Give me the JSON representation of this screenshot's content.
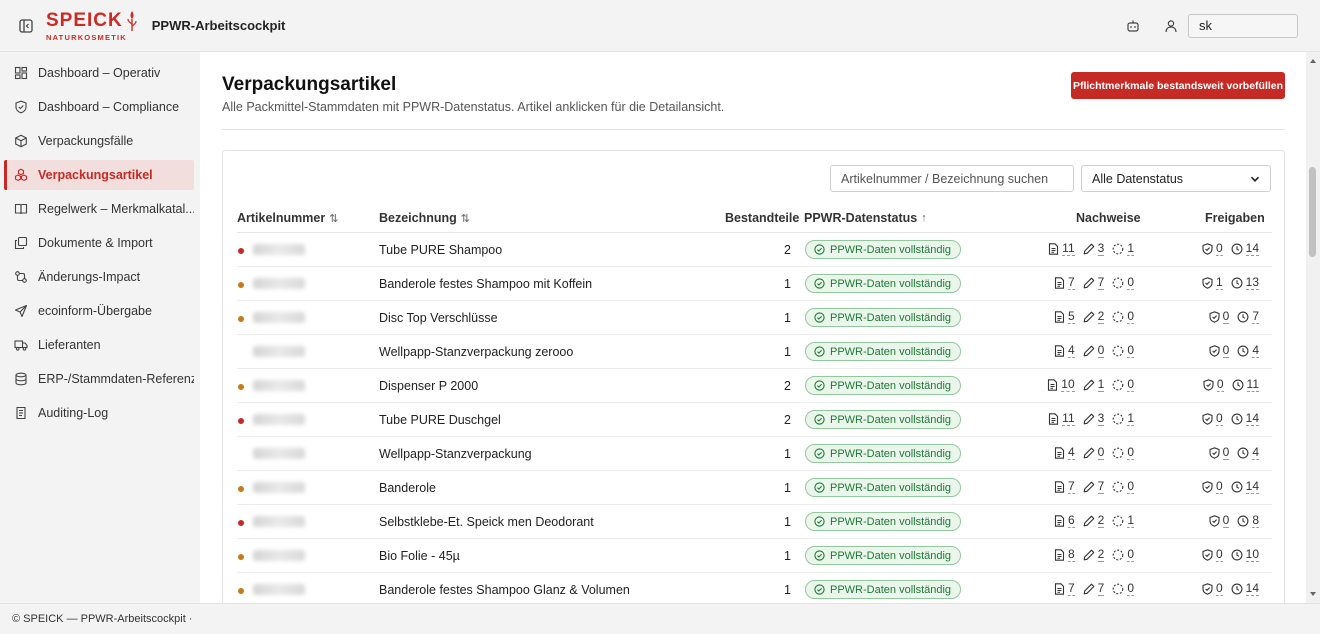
{
  "header": {
    "brand_word": "SPEICK",
    "brand_sub": "NATURKOSMETIK",
    "app_title": "PPWR-Arbeitscockpit",
    "user_value": "sk"
  },
  "sidebar": {
    "items": [
      {
        "label": "Dashboard – Operativ",
        "icon": "dashboard-grid-icon"
      },
      {
        "label": "Dashboard – Compliance",
        "icon": "shield-check-icon"
      },
      {
        "label": "Verpackungsfälle",
        "icon": "package-icon"
      },
      {
        "label": "Verpackungsartikel",
        "icon": "boxes-icon",
        "active": true
      },
      {
        "label": "Regelwerk – Merkmalkatal...",
        "icon": "book-icon"
      },
      {
        "label": "Dokumente & Import",
        "icon": "documents-icon"
      },
      {
        "label": "Änderungs-Impact",
        "icon": "impact-icon"
      },
      {
        "label": "ecoinform-Übergabe",
        "icon": "send-icon"
      },
      {
        "label": "Lieferanten",
        "icon": "truck-icon"
      },
      {
        "label": "ERP-/Stammdaten-Referenz",
        "icon": "database-icon"
      },
      {
        "label": "Auditing-Log",
        "icon": "log-icon"
      }
    ]
  },
  "main": {
    "title": "Verpackungsartikel",
    "subtitle": "Alle Packmittel-Stammdaten mit PPWR-Datenstatus. Artikel anklicken für die Detailansicht.",
    "prefill_button": "Pflichtmerkmale bestandsweit vorbefüllen",
    "search_placeholder": "Artikelnummer / Bezeichnung suchen",
    "status_filter": "Alle Datenstatus"
  },
  "table": {
    "columns": {
      "artikelnummer": "Artikelnummer",
      "bezeichnung": "Bezeichnung",
      "bestandteile": "Bestandteile",
      "datenstatus": "PPWR-Datenstatus",
      "nachweise": "Nachweise",
      "freigaben": "Freigaben"
    },
    "rows": [
      {
        "dot": "#c62a24",
        "bezeichnung": "Tube PURE Shampoo",
        "bestandteile": "2",
        "status": "PPWR-Daten vollständig",
        "docs": "11",
        "edits": "3",
        "pending": "1",
        "approved": "0",
        "waiting": "14"
      },
      {
        "dot": "#c97a16",
        "bezeichnung": "Banderole festes Shampoo mit Koffein",
        "bestandteile": "1",
        "status": "PPWR-Daten vollständig",
        "docs": "7",
        "edits": "7",
        "pending": "0",
        "approved": "1",
        "waiting": "13"
      },
      {
        "dot": "#c97a16",
        "bezeichnung": "Disc Top Verschlüsse",
        "bestandteile": "1",
        "status": "PPWR-Daten vollständig",
        "docs": "5",
        "edits": "2",
        "pending": "0",
        "approved": "0",
        "waiting": "7"
      },
      {
        "dot": "",
        "bezeichnung": "Wellpapp-Stanzverpackung zerooo",
        "bestandteile": "1",
        "status": "PPWR-Daten vollständig",
        "docs": "4",
        "edits": "0",
        "pending": "0",
        "approved": "0",
        "waiting": "4"
      },
      {
        "dot": "#c97a16",
        "bezeichnung": "Dispenser P 2000",
        "bestandteile": "2",
        "status": "PPWR-Daten vollständig",
        "docs": "10",
        "edits": "1",
        "pending": "0",
        "approved": "0",
        "waiting": "11"
      },
      {
        "dot": "#c62a24",
        "bezeichnung": "Tube PURE Duschgel",
        "bestandteile": "2",
        "status": "PPWR-Daten vollständig",
        "docs": "11",
        "edits": "3",
        "pending": "1",
        "approved": "0",
        "waiting": "14"
      },
      {
        "dot": "",
        "bezeichnung": "Wellpapp-Stanzverpackung",
        "bestandteile": "1",
        "status": "PPWR-Daten vollständig",
        "docs": "4",
        "edits": "0",
        "pending": "0",
        "approved": "0",
        "waiting": "4"
      },
      {
        "dot": "#c97a16",
        "bezeichnung": "Banderole",
        "bestandteile": "1",
        "status": "PPWR-Daten vollständig",
        "docs": "7",
        "edits": "7",
        "pending": "0",
        "approved": "0",
        "waiting": "14"
      },
      {
        "dot": "#c62a24",
        "bezeichnung": "Selbstklebe-Et. Speick men Deodorant",
        "bestandteile": "1",
        "status": "PPWR-Daten vollständig",
        "docs": "6",
        "edits": "2",
        "pending": "1",
        "approved": "0",
        "waiting": "8"
      },
      {
        "dot": "#c97a16",
        "bezeichnung": "Bio Folie - 45µ",
        "bestandteile": "1",
        "status": "PPWR-Daten vollständig",
        "docs": "8",
        "edits": "2",
        "pending": "0",
        "approved": "0",
        "waiting": "10"
      },
      {
        "dot": "#c97a16",
        "bezeichnung": "Banderole festes Shampoo Glanz & Volumen",
        "bestandteile": "1",
        "status": "PPWR-Daten vollständig",
        "docs": "7",
        "edits": "7",
        "pending": "0",
        "approved": "0",
        "waiting": "14"
      }
    ]
  },
  "footer": {
    "text": "© SPEICK — PPWR-Arbeitscockpit ·"
  },
  "colors": {
    "brand_red": "#c62a24",
    "status_green": "#1d7a33",
    "dot_orange": "#c97a16"
  }
}
